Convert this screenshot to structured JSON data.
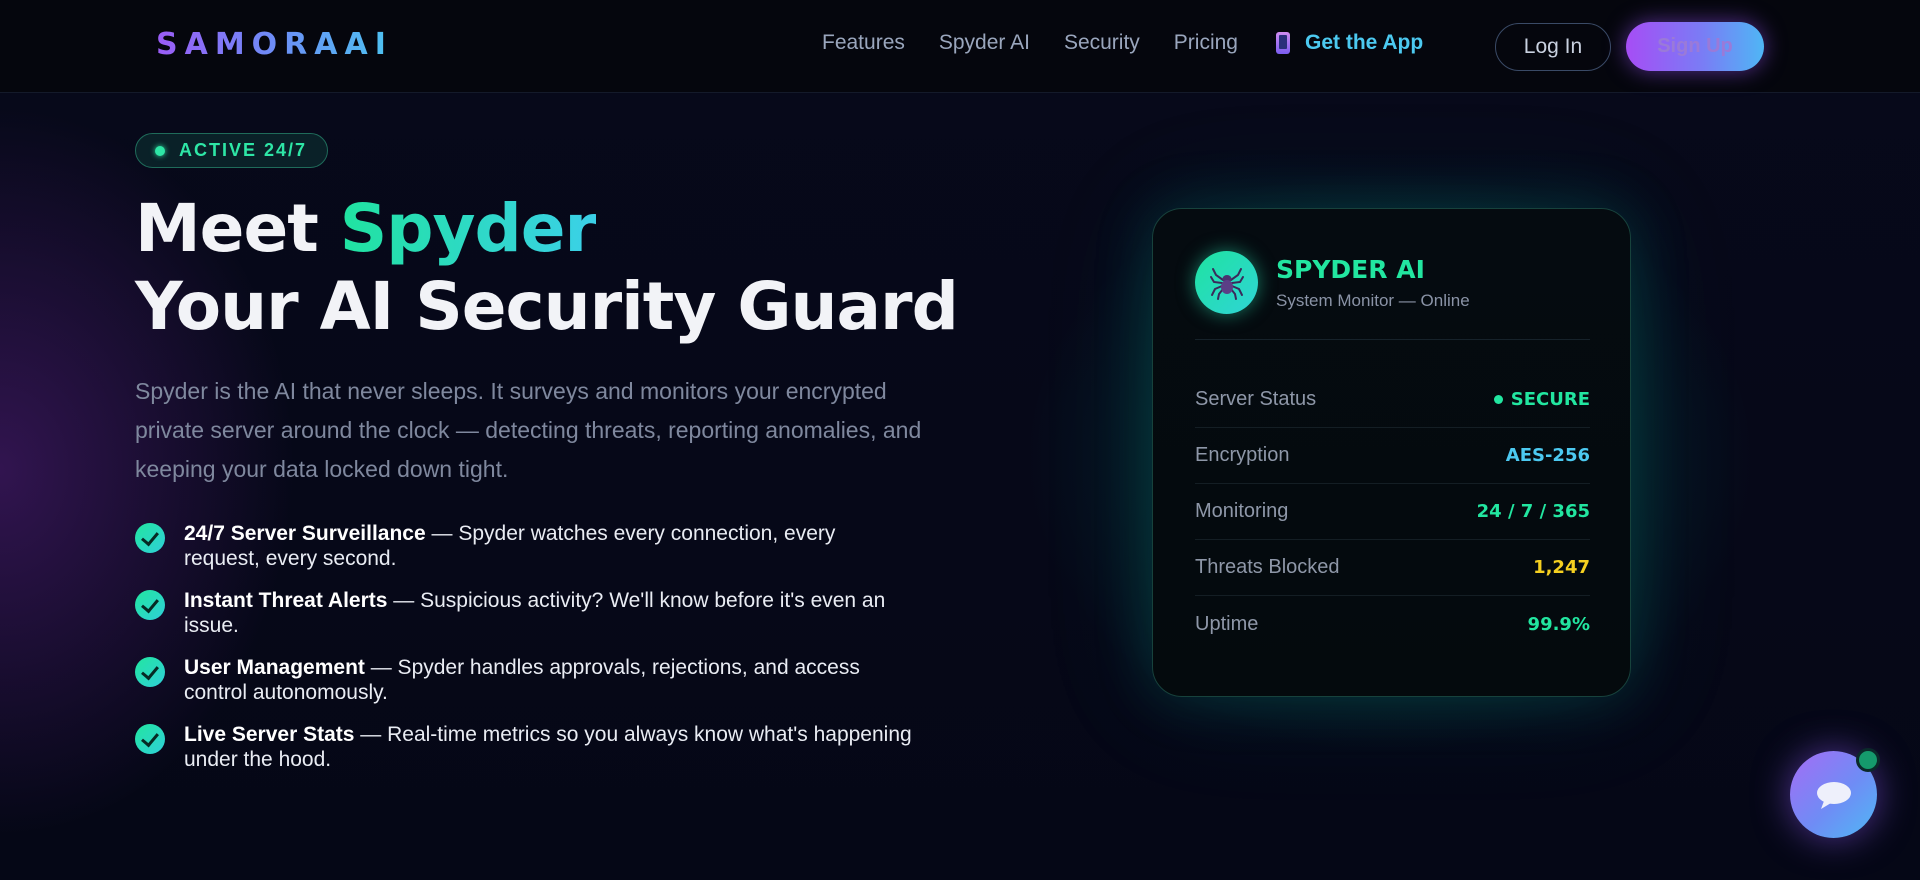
{
  "nav": {
    "logo": "SAMORAAI",
    "links": [
      "Features",
      "Spyder AI",
      "Security",
      "Pricing"
    ],
    "get_app": "Get the App",
    "login": "Log In",
    "signup": "Sign Up"
  },
  "hero": {
    "badge": "ACTIVE 24/7",
    "title_prefix": "Meet ",
    "title_accent": "Spyder",
    "title_line2": "Your AI Security Guard",
    "description": "Spyder is the AI that never sleeps. It surveys and monitors your encrypted private server around the clock — detecting threats, reporting anomalies, and keeping your data locked down tight.",
    "features": [
      {
        "title": "24/7 Server Surveillance",
        "desc": " — Spyder watches every connection, every request, every second."
      },
      {
        "title": "Instant Threat Alerts",
        "desc": " — Suspicious activity? We'll know before it's even an issue."
      },
      {
        "title": "User Management",
        "desc": " — Spyder handles approvals, rejections, and access control autonomously."
      },
      {
        "title": "Live Server Stats",
        "desc": " — Real-time metrics so you always know what's happening under the hood."
      }
    ]
  },
  "card": {
    "title": "SPYDER AI",
    "subtitle": "System Monitor — Online",
    "stats": [
      {
        "label": "Server Status",
        "value": "SECURE",
        "color": "#22e6a0"
      },
      {
        "label": "Encryption",
        "value": "AES-256",
        "color": "#4cc9f0"
      },
      {
        "label": "Monitoring",
        "value": "24 / 7 / 365",
        "color": "#22e6a0"
      },
      {
        "label": "Threats Blocked",
        "value": "1,247",
        "color": "#f5d020"
      },
      {
        "label": "Uptime",
        "value": "99.9%",
        "color": "#22e6a0"
      }
    ]
  },
  "icons": {
    "phone": "phone-icon",
    "spider": "spider-icon",
    "check": "check-icon",
    "chat": "chat-icon"
  },
  "colors": {
    "accent_green": "#22e6a0",
    "accent_cyan": "#4cc9f0",
    "accent_purple": "#a64df5",
    "warning_yellow": "#f5d020"
  }
}
